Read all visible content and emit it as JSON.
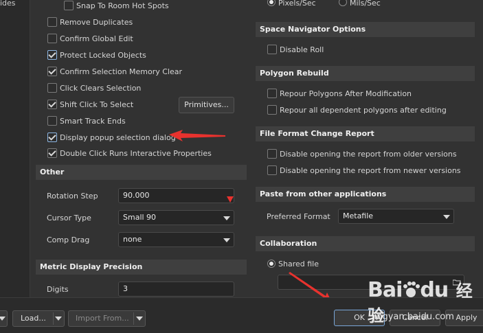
{
  "left_strip": {
    "cut_text": "ides"
  },
  "left_options": [
    {
      "label": "Snap To Room Hot Spots",
      "checked": false
    },
    {
      "label": "Remove Duplicates",
      "checked": false
    },
    {
      "label": "Confirm Global Edit",
      "checked": false
    },
    {
      "label": "Protect Locked Objects",
      "checked": true
    },
    {
      "label": "Confirm Selection Memory Clear",
      "checked": true
    },
    {
      "label": "Click Clears Selection",
      "checked": false
    },
    {
      "label": "Shift Click To Select",
      "checked": true
    },
    {
      "label": "Smart Track Ends",
      "checked": false
    },
    {
      "label": "Display popup selection dialog",
      "checked": true
    },
    {
      "label": "Double Click Runs Interactive Properties",
      "checked": true
    }
  ],
  "primitives_button": "Primitives...",
  "other": {
    "title": "Other",
    "rotation_step_label": "Rotation Step",
    "rotation_step_value": "90.000",
    "cursor_type_label": "Cursor Type",
    "cursor_type_value": "Small 90",
    "comp_drag_label": "Comp Drag",
    "comp_drag_value": "none"
  },
  "metric": {
    "title": "Metric Display Precision",
    "digits_label": "Digits",
    "digits_value": "3"
  },
  "units": {
    "pixels": "Pixels/Sec",
    "mils": "Mils/Sec",
    "selected": "pixels"
  },
  "space_nav": {
    "title": "Space Navigator Options",
    "disable_roll": "Disable Roll"
  },
  "polygon": {
    "title": "Polygon Rebuild",
    "repour_after_mod": "Repour Polygons After Modification",
    "repour_dependent": "Repour all dependent polygons after editing"
  },
  "file_format": {
    "title": "File Format Change Report",
    "older": "Disable opening the report from older versions",
    "newer": "Disable opening the report from newer versions"
  },
  "paste": {
    "title": "Paste from other applications",
    "preferred_label": "Preferred Format",
    "preferred_value": "Metafile"
  },
  "collab": {
    "title": "Collaboration",
    "shared_file": "Shared file",
    "path_value": ""
  },
  "bottom": {
    "load": "Load...",
    "import_from": "Import From...",
    "ok": "OK",
    "cancel": "Cancel",
    "apply": "Apply"
  },
  "watermark": {
    "brand": "Bai",
    "brand2": "du",
    "cn": "经验",
    "url": "jingyan.baidu.com"
  },
  "colors": {
    "accent_arrow": "#e8322e",
    "panel": "#323232",
    "section": "#3f3f3f"
  }
}
